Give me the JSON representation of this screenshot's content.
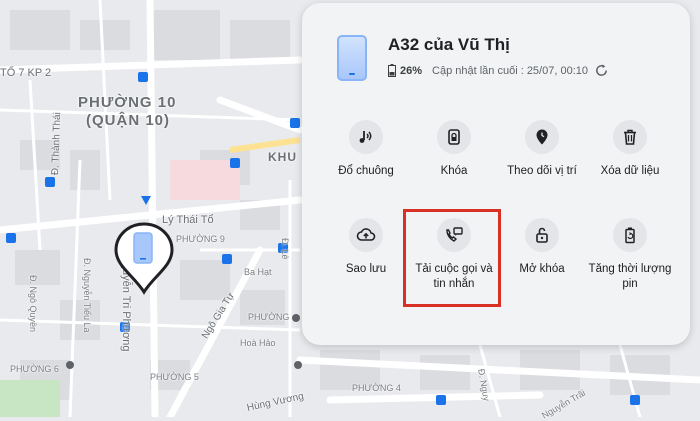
{
  "map": {
    "labels": {
      "to7": "TỔ 7 KP 2",
      "ward10": "PHƯỜNG 10",
      "district10": "(QUẬN 10)",
      "thanhThai": "Đ. Thành Thái",
      "lyThaiTo": "Lý Thái Tổ",
      "ward9": "PHƯỜNG 9",
      "baHat": "Ba Hạt",
      "khu": "KHU",
      "tieuLa": "Đ. Ngô Quyền",
      "tieuLa2": "Đ. Nguyễn Tiểu La",
      "triPhuong": "Nguyễn Tri Phương",
      "ngoGiaTu": "Ngô Gia Tự",
      "phuong": "PHƯỜNG",
      "hoaHao": "Hoà Hảo",
      "ward5": "PHƯỜNG 5",
      "ward6": "PHƯỜNG 6",
      "ward4": "PHƯỜNG 4",
      "hungVuong": "Hùng Vương",
      "dLe": "Đ. Lê",
      "dNguyen": "Đ. Nguy",
      "nguyenTrai": "Nguyễn Trãi"
    }
  },
  "device": {
    "name": "A32 của Vũ Thị",
    "battery": "26%",
    "updated": "Cập nhật lần cuối : 25/07, 00:10"
  },
  "actions": [
    {
      "label": "Đổ chuông",
      "icon": "ring-icon"
    },
    {
      "label": "Khóa",
      "icon": "lock-icon"
    },
    {
      "label": "Theo dõi vị trí",
      "icon": "location-icon"
    },
    {
      "label": "Xóa dữ liệu",
      "icon": "trash-icon"
    },
    {
      "label": "Sao lưu",
      "icon": "cloud-upload-icon"
    },
    {
      "label": "Tải cuộc gọi và tin nhắn",
      "icon": "call-message-icon"
    },
    {
      "label": "Mở khóa",
      "icon": "unlock-icon"
    },
    {
      "label": "Tăng thời lượng pin",
      "icon": "battery-saver-icon"
    }
  ]
}
